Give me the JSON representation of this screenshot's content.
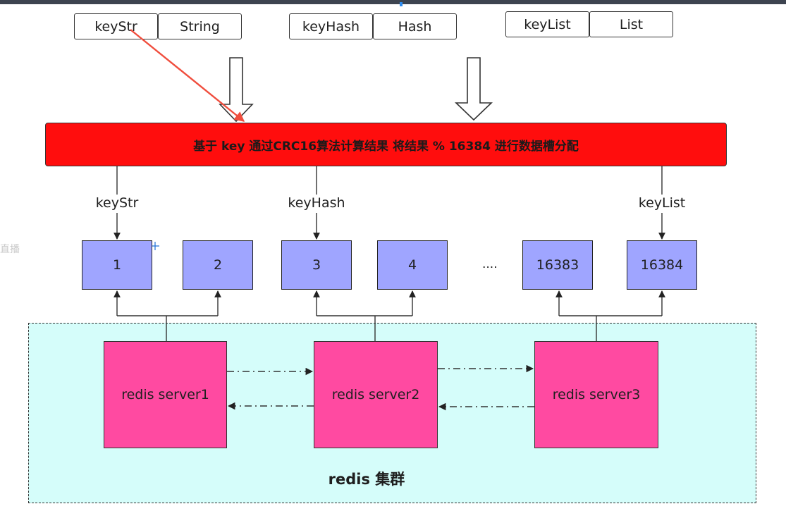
{
  "key_groups": [
    {
      "name": "keyStr",
      "type": "String"
    },
    {
      "name": "keyHash",
      "type": "Hash"
    },
    {
      "name": "keyList",
      "type": "List"
    }
  ],
  "hash_bar": {
    "text": "基于 key 通过CRC16算法计算结果 将结果 % 16384 进行数据槽分配"
  },
  "edge_labels": [
    "keyStr",
    "keyHash",
    "keyList"
  ],
  "slots": [
    "1",
    "2",
    "3",
    "4",
    "16383",
    "16384"
  ],
  "ellipsis": "....",
  "servers": [
    "redis server1",
    "redis server2",
    "redis server3"
  ],
  "cluster_label": "redis 集群",
  "ghost_text": "直播",
  "colors": {
    "hash_bar": "#ff0d0d",
    "slot": "#9fa5ff",
    "server": "#ff4aa1",
    "cluster_bg": "#d5fdfa",
    "annotation_arrow": "#f04e3e"
  }
}
